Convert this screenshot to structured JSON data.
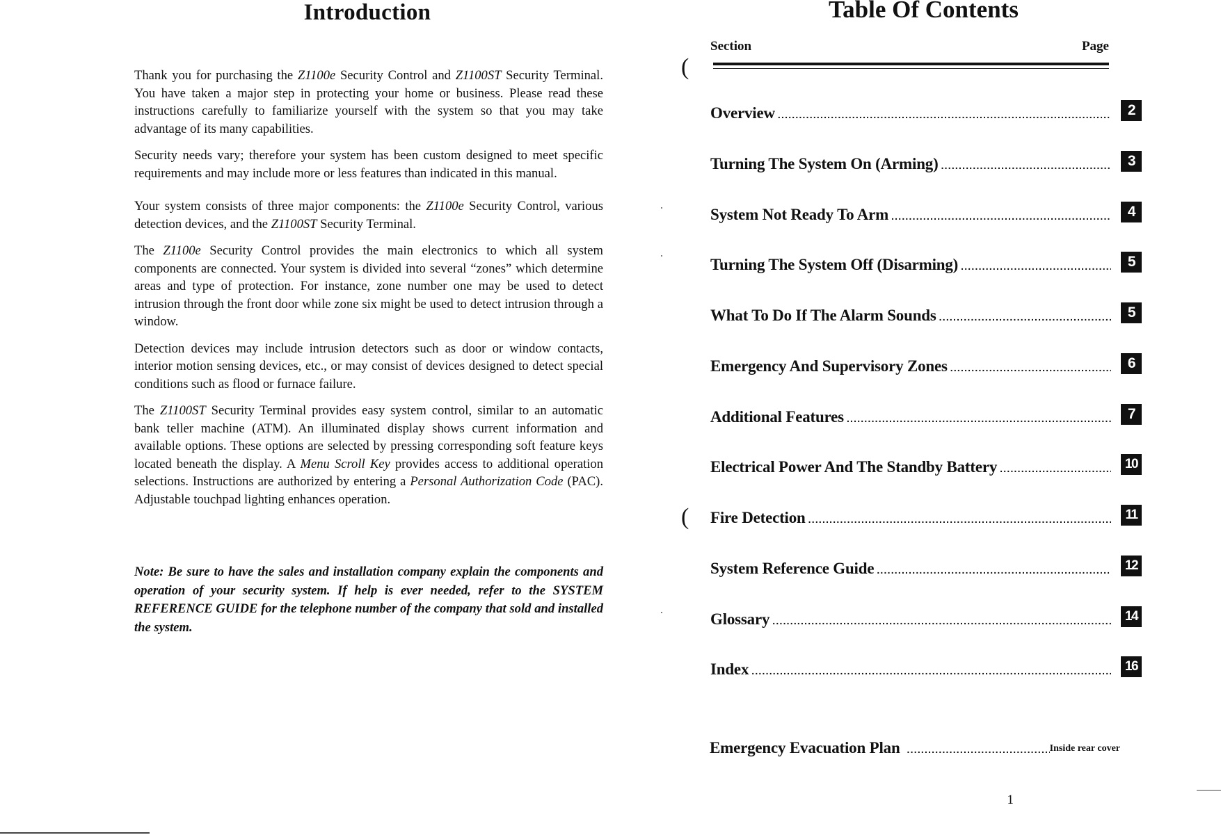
{
  "left_page": {
    "title": "Introduction",
    "paragraphs": [
      {
        "parts": [
          {
            "t": "Thank you for purchasing the "
          },
          {
            "t": "Z1100e",
            "i": true
          },
          {
            "t": " Security Control and "
          },
          {
            "t": "Z1100ST",
            "i": true
          },
          {
            "t": " Security Terminal. You have taken a major step in protecting your home or business. Please read these instructions carefully to familiarize yourself with the system so that you may take advantage of its many capabilities."
          }
        ]
      },
      {
        "parts": [
          {
            "t": "Security needs vary; therefore your system has been custom designed to meet specific requirements and may include more or less features than indicated in this manual."
          }
        ]
      },
      {
        "gap": true,
        "parts": [
          {
            "t": "Your system consists of three major components:  the "
          },
          {
            "t": "Z1100e",
            "i": true
          },
          {
            "t": " Security Control, various detection devices, and the "
          },
          {
            "t": "Z1100ST",
            "i": true
          },
          {
            "t": "  Security Terminal."
          }
        ]
      },
      {
        "parts": [
          {
            "t": "The "
          },
          {
            "t": "Z1100e",
            "i": true
          },
          {
            "t": " Security Control provides the main electronics to which all system components are connected. Your system is divided into several “zones” which determine areas and type of protection. For instance, zone number one may be used to detect intrusion through the front door while zone six might be used to detect intrusion through a window."
          }
        ]
      },
      {
        "parts": [
          {
            "t": "Detection devices may include intrusion detectors such as door or window contacts, interior motion sensing devices, etc., or may consist of devices designed to detect special conditions such as flood or furnace failure."
          }
        ]
      },
      {
        "parts": [
          {
            "t": "The "
          },
          {
            "t": "Z1100ST",
            "i": true
          },
          {
            "t": "  Security Terminal provides easy system control, similar to an automatic bank teller machine (ATM).  An illuminated display shows current information and available options. These options are selected by pressing corresponding soft feature keys located beneath the display.  A "
          },
          {
            "t": "Menu Scroll Key",
            "i": true
          },
          {
            "t": " provides access to additional operation selections.  Instructions are authorized by entering a "
          },
          {
            "t": "Personal Authorization Code",
            "i": true
          },
          {
            "t": " (PAC).   Adjustable touchpad lighting enhances operation."
          }
        ]
      }
    ],
    "note": "Note: Be sure to have the sales and installation company explain the components and operation of your security system. If help is ever needed, refer to the SYSTEM REFERENCE GUIDE for the telephone number of the company that sold and installed the system."
  },
  "right_page": {
    "title": "Table Of Contents",
    "header": {
      "section": "Section",
      "page": "Page"
    },
    "entries": [
      {
        "label": "Overview",
        "page": "2"
      },
      {
        "label": "Turning The System On (Arming)",
        "page": "3"
      },
      {
        "label": "System Not Ready To Arm",
        "page": "4"
      },
      {
        "label": "Turning The System Off (Disarming)",
        "page": "5"
      },
      {
        "label": "What To Do If The Alarm Sounds",
        "page": "5"
      },
      {
        "label": "Emergency And Supervisory Zones",
        "page": "6"
      },
      {
        "label": "Additional Features",
        "page": "7"
      },
      {
        "label": "Electrical Power And The Standby Battery",
        "page": "10"
      },
      {
        "label": "Fire Detection",
        "page": "11"
      },
      {
        "label": "System Reference Guide",
        "page": "12"
      },
      {
        "label": "Glossary",
        "page": "14"
      },
      {
        "label": "Index",
        "page": "16"
      }
    ],
    "evacuation": {
      "label": "Emergency Evacuation Plan",
      "page": "Inside rear cover"
    },
    "page_number": "1"
  },
  "scan_marks": {
    "paren": "("
  }
}
